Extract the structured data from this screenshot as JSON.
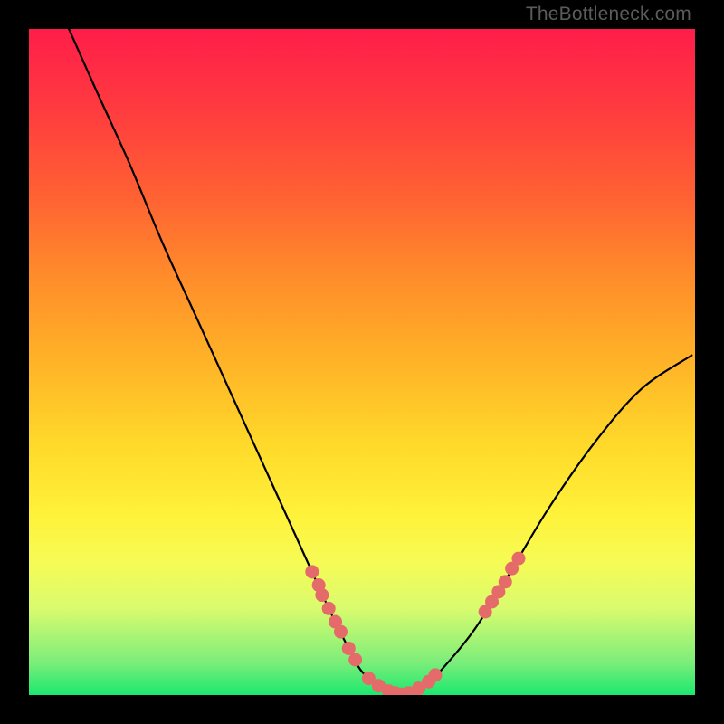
{
  "watermark": "TheBottleneck.com",
  "chart_data": {
    "type": "line",
    "title": "",
    "xlabel": "",
    "ylabel": "",
    "xlim": [
      0,
      100
    ],
    "ylim": [
      0,
      100
    ],
    "series": [
      {
        "name": "curve-left",
        "x": [
          6,
          10,
          15,
          20,
          25,
          30,
          35,
          40,
          45,
          48,
          50,
          53,
          56
        ],
        "y": [
          100,
          91,
          80,
          68,
          57,
          46,
          35,
          24,
          13,
          7,
          3.5,
          1,
          0
        ]
      },
      {
        "name": "curve-right",
        "x": [
          56,
          60,
          63,
          67,
          72,
          78,
          85,
          92,
          99.5
        ],
        "y": [
          0,
          2,
          5,
          10,
          18,
          28,
          38,
          46,
          51
        ]
      }
    ],
    "markers": [
      {
        "name": "left-cluster",
        "color": "#e56a6a",
        "points": [
          {
            "x": 42.5,
            "y": 18.5
          },
          {
            "x": 43.5,
            "y": 16.5
          },
          {
            "x": 44,
            "y": 15
          },
          {
            "x": 45,
            "y": 13
          },
          {
            "x": 46,
            "y": 11
          },
          {
            "x": 46.8,
            "y": 9.5
          },
          {
            "x": 48,
            "y": 7
          },
          {
            "x": 49,
            "y": 5.3
          }
        ]
      },
      {
        "name": "bottom-cluster",
        "color": "#e56a6a",
        "points": [
          {
            "x": 51,
            "y": 2.5
          },
          {
            "x": 52.5,
            "y": 1.4
          },
          {
            "x": 54,
            "y": 0.6
          },
          {
            "x": 55,
            "y": 0.3
          },
          {
            "x": 56,
            "y": 0.1
          },
          {
            "x": 57,
            "y": 0.3
          },
          {
            "x": 58.5,
            "y": 1.0
          },
          {
            "x": 60,
            "y": 2.0
          },
          {
            "x": 61,
            "y": 3.0
          }
        ]
      },
      {
        "name": "right-cluster",
        "color": "#e56a6a",
        "points": [
          {
            "x": 68.5,
            "y": 12.5
          },
          {
            "x": 69.5,
            "y": 14
          },
          {
            "x": 70.5,
            "y": 15.5
          },
          {
            "x": 71.5,
            "y": 17
          },
          {
            "x": 72.5,
            "y": 19
          },
          {
            "x": 73.5,
            "y": 20.5
          }
        ]
      }
    ]
  }
}
